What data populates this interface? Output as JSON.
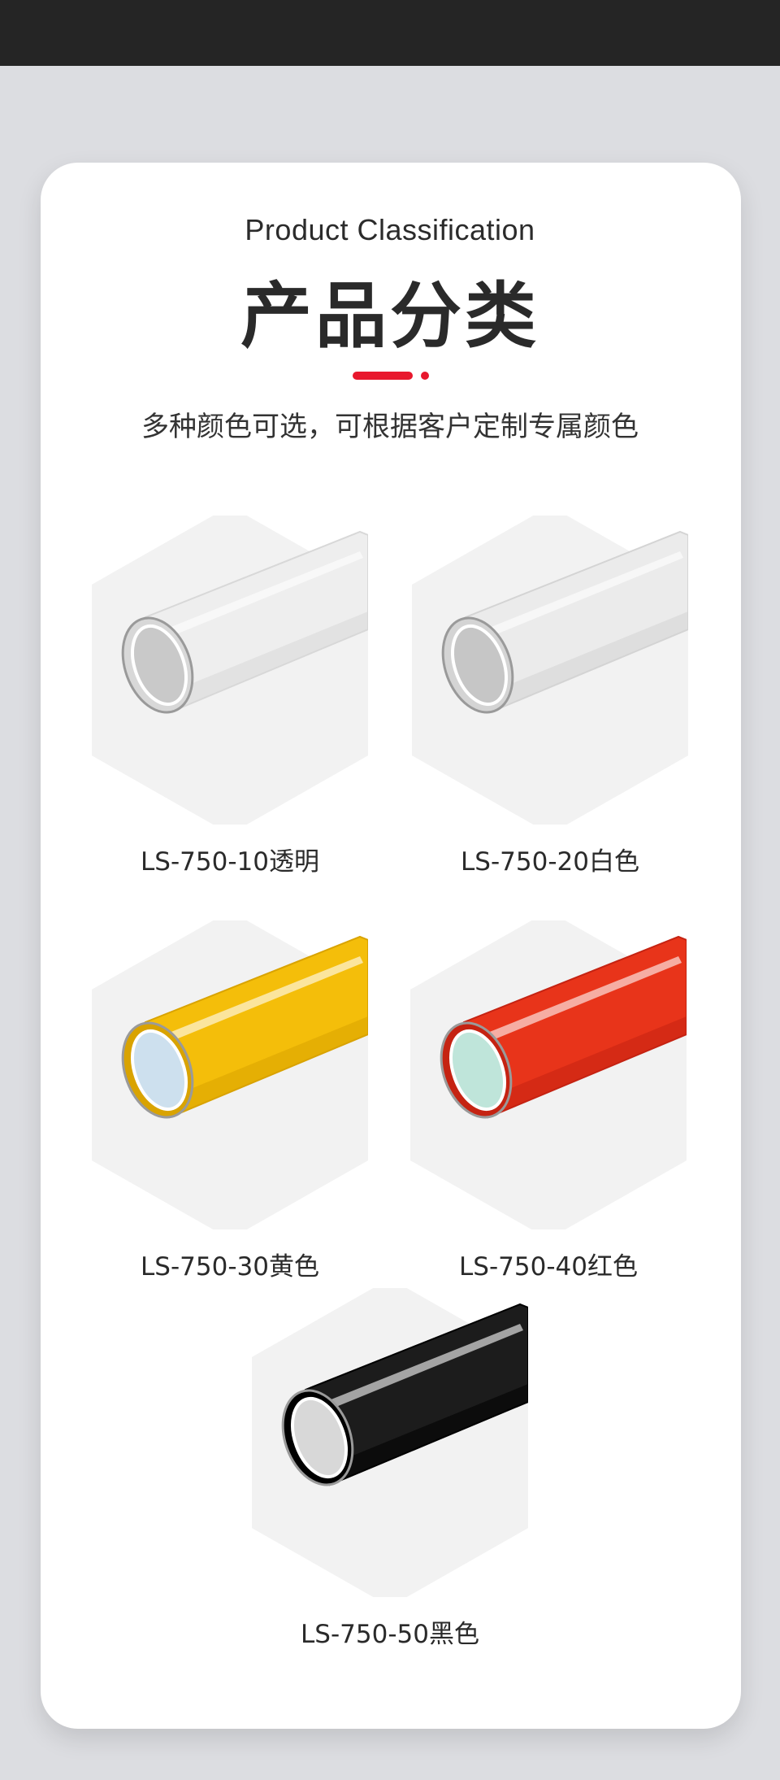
{
  "header": {
    "title_en": "Product Classification",
    "title_cn": "产品分类",
    "subtitle": "多种颜色可选，可根据客户定制专属颜色",
    "accent_color": "#e8182d"
  },
  "products": [
    {
      "label": "LS-750-10透明",
      "roll_color": "#eeeeee",
      "roll_shade": "#d8d8d8",
      "core_color": "#c9c9c9",
      "icon": "tape-roll-clear"
    },
    {
      "label": "LS-750-20白色",
      "roll_color": "#ebebeb",
      "roll_shade": "#d4d4d4",
      "core_color": "#c6c6c6",
      "icon": "tape-roll-white"
    },
    {
      "label": "LS-750-30黄色",
      "roll_color": "#f4be0a",
      "roll_shade": "#d9a300",
      "core_color": "#cde0ee",
      "icon": "tape-roll-yellow"
    },
    {
      "label": "LS-750-40红色",
      "roll_color": "#e8341a",
      "roll_shade": "#c52312",
      "core_color": "#bfe5da",
      "icon": "tape-roll-red"
    },
    {
      "label": "LS-750-50黑色",
      "roll_color": "#1c1c1c",
      "roll_shade": "#000000",
      "core_color": "#d8d8d8",
      "icon": "tape-roll-black"
    }
  ]
}
